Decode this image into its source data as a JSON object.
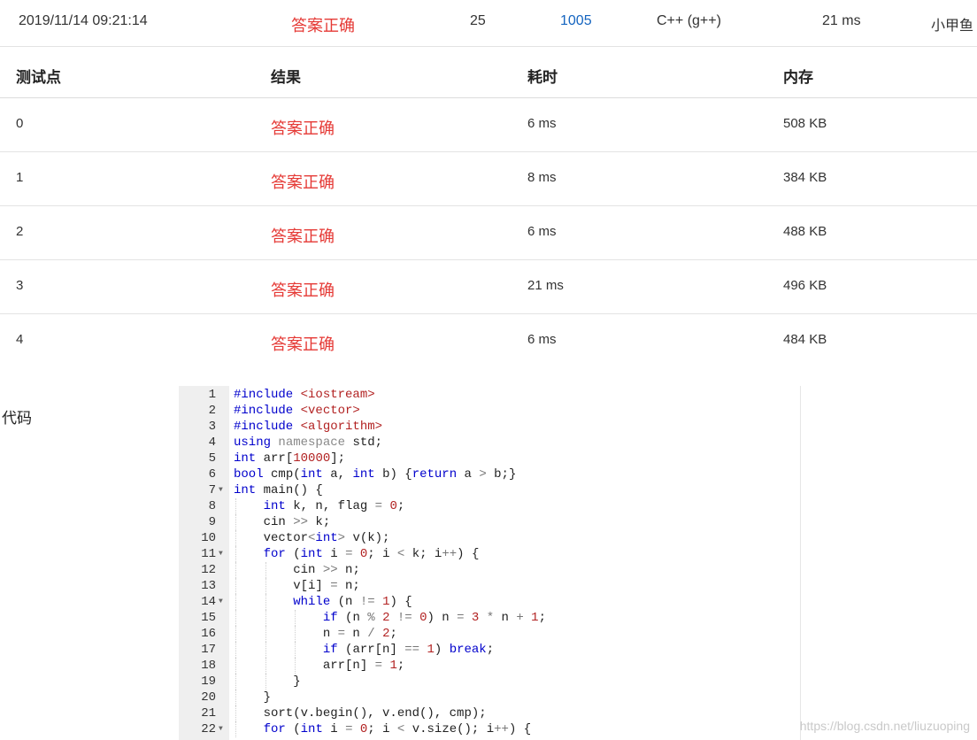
{
  "submission": {
    "time": "2019/11/14 09:21:14",
    "status": "答案正确",
    "score": "25",
    "problem": "1005",
    "language": "C++ (g++)",
    "time_used": "21 ms",
    "user": "小甲鱼"
  },
  "cases": {
    "headers": [
      "测试点",
      "结果",
      "耗时",
      "内存"
    ],
    "rows": [
      {
        "id": "0",
        "result": "答案正确",
        "time": "6 ms",
        "memory": "508 KB"
      },
      {
        "id": "1",
        "result": "答案正确",
        "time": "8 ms",
        "memory": "384 KB"
      },
      {
        "id": "2",
        "result": "答案正确",
        "time": "6 ms",
        "memory": "488 KB"
      },
      {
        "id": "3",
        "result": "答案正确",
        "time": "21 ms",
        "memory": "496 KB"
      },
      {
        "id": "4",
        "result": "答案正确",
        "time": "6 ms",
        "memory": "484 KB"
      }
    ]
  },
  "code": {
    "label": "代码",
    "lines": [
      {
        "n": "1",
        "text": "#include <iostream>"
      },
      {
        "n": "2",
        "text": "#include <vector>"
      },
      {
        "n": "3",
        "text": "#include <algorithm>"
      },
      {
        "n": "4",
        "text": "using namespace std;"
      },
      {
        "n": "5",
        "text": "int arr[10000];"
      },
      {
        "n": "6",
        "text": "bool cmp(int a, int b) {return a > b;}"
      },
      {
        "n": "7",
        "text": "int main() {",
        "fold": true
      },
      {
        "n": "8",
        "text": "    int k, n, flag = 0;"
      },
      {
        "n": "9",
        "text": "    cin >> k;"
      },
      {
        "n": "10",
        "text": "    vector<int> v(k);"
      },
      {
        "n": "11",
        "text": "    for (int i = 0; i < k; i++) {",
        "fold": true
      },
      {
        "n": "12",
        "text": "        cin >> n;"
      },
      {
        "n": "13",
        "text": "        v[i] = n;"
      },
      {
        "n": "14",
        "text": "        while (n != 1) {",
        "fold": true
      },
      {
        "n": "15",
        "text": "            if (n % 2 != 0) n = 3 * n + 1;"
      },
      {
        "n": "16",
        "text": "            n = n / 2;"
      },
      {
        "n": "17",
        "text": "            if (arr[n] == 1) break;"
      },
      {
        "n": "18",
        "text": "            arr[n] = 1;"
      },
      {
        "n": "19",
        "text": "        }"
      },
      {
        "n": "20",
        "text": "    }"
      },
      {
        "n": "21",
        "text": "    sort(v.begin(), v.end(), cmp);"
      },
      {
        "n": "22",
        "text": "    for (int i = 0; i < v.size(); i++) {",
        "fold": true
      }
    ]
  },
  "watermark": "https://blog.csdn.net/liuzuoping"
}
